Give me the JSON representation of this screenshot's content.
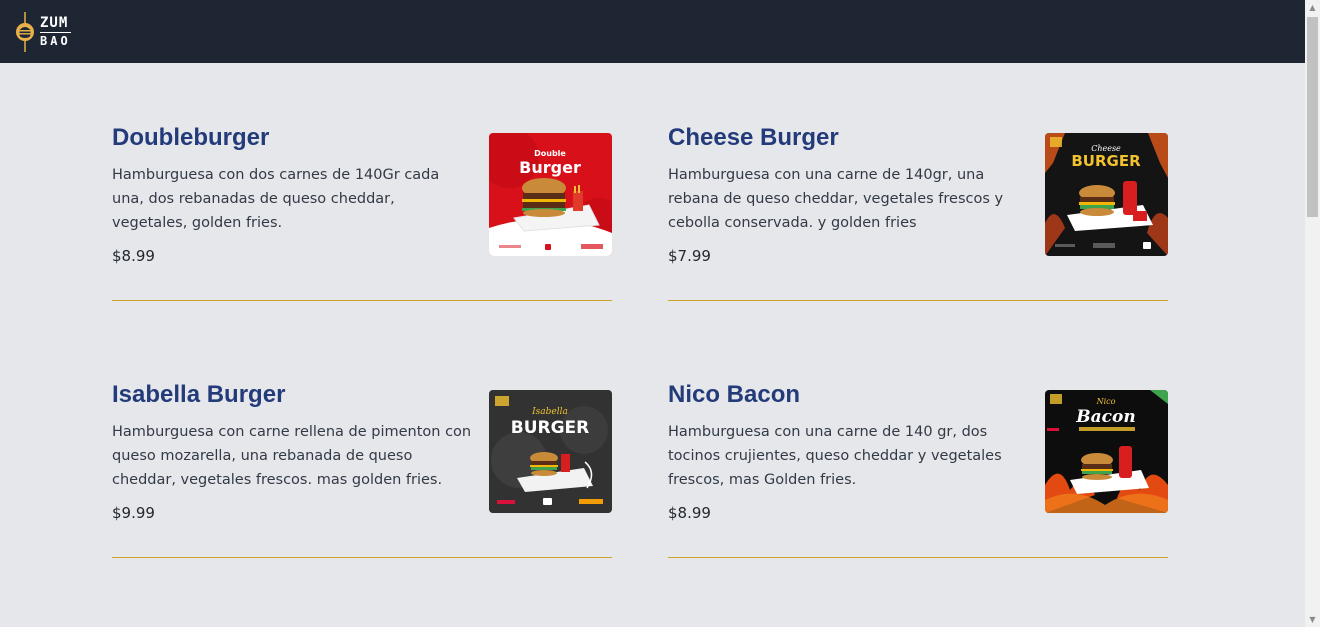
{
  "brand": {
    "line1": "ZUM",
    "line2": "BAO"
  },
  "colors": {
    "navbar": "#1e2533",
    "accent": "#c9a227",
    "title": "#243b7a",
    "background": "#e5e7eb"
  },
  "menu": [
    {
      "title": "Doubleburger",
      "description": "Hamburguesa con dos carnes de 140Gr cada una, dos rebanadas de queso cheddar, vegetales, golden fries.",
      "price": "$8.99",
      "image": {
        "heading_small": "Double",
        "heading_large": "Burger",
        "theme": "red"
      }
    },
    {
      "title": "Cheese Burger",
      "description": "Hamburguesa con una carne de 140gr, una rebana de queso cheddar, vegetales frescos y cebolla conservada. y golden fries",
      "price": "$7.99",
      "image": {
        "heading_small": "Cheese",
        "heading_large": "BURGER",
        "theme": "dark-fire"
      }
    },
    {
      "title": "Isabella Burger",
      "description": "Hamburguesa con carne rellena de pimenton con queso mozarella, una rebanada de queso cheddar, vegetales frescos. mas golden fries.",
      "price": "$9.99",
      "image": {
        "heading_small": "Isabella",
        "heading_large": "BURGER",
        "theme": "dark-stone"
      }
    },
    {
      "title": "Nico Bacon",
      "description": "Hamburguesa con una carne de 140 gr, dos tocinos crujientes, queso cheddar y vegetales frescos, mas Golden fries.",
      "price": "$8.99",
      "image": {
        "heading_small": "Nico",
        "heading_large": "Bacon",
        "theme": "dark-fire"
      }
    }
  ]
}
